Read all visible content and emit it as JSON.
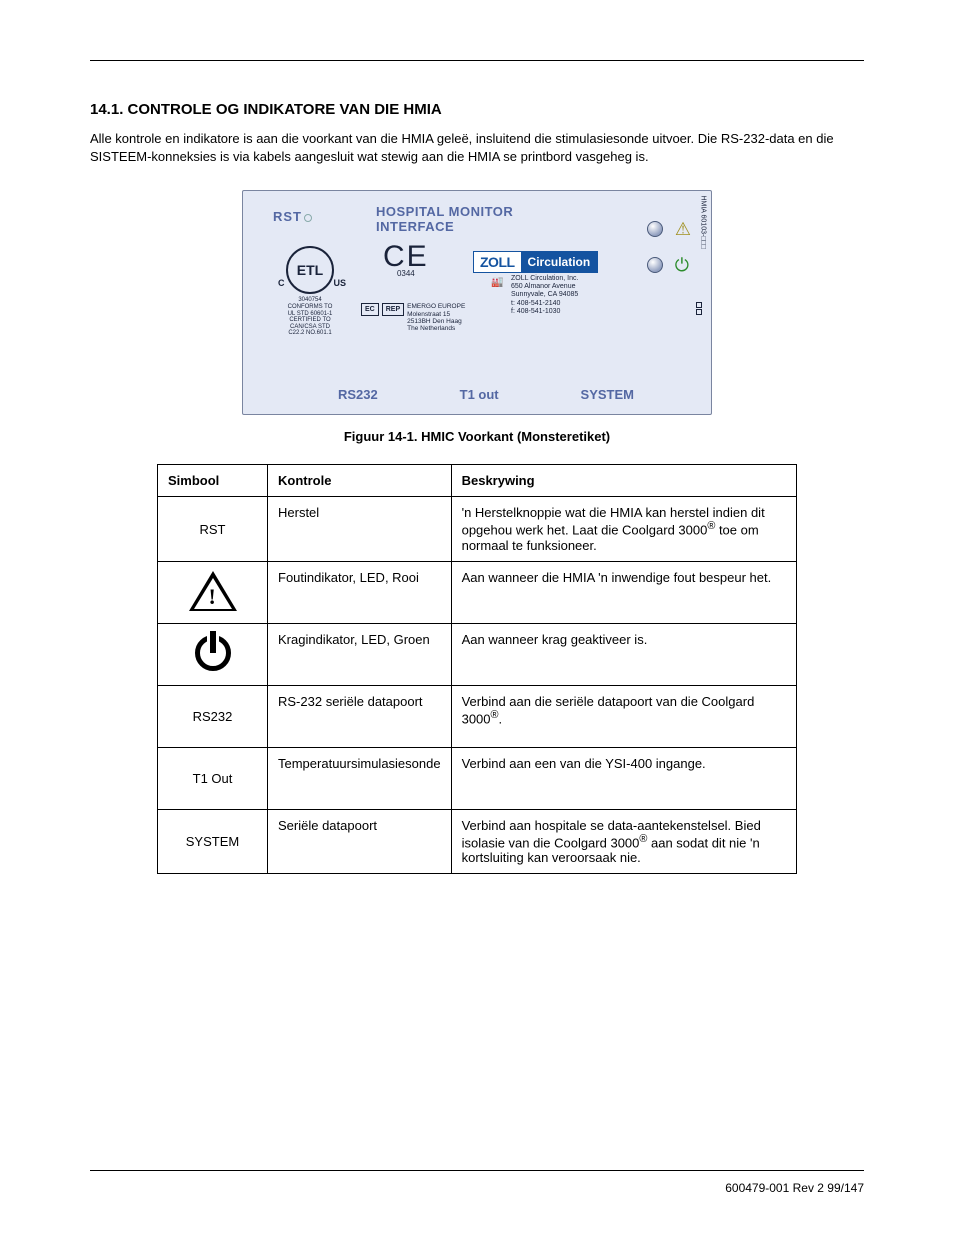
{
  "heading": "14.1. CONTROLE OG INDIKATORE VAN DIE HMIA",
  "intro_paragraph": "Alle kontrole en indikatore is aan die voorkant van die HMIA geleë, insluitend die stimulasiesonde uitvoer. Die RS-232-data en die SISTEEM-konneksies is via kabels aangesluit wat stewig aan die HMIA se printbord vasgeheg is.",
  "panel": {
    "rst": "RST",
    "title_line1": "HOSPITAL MONITOR",
    "title_line2": "INTERFACE",
    "ce_num": "0344",
    "etl_number": "3040754",
    "etl_line1": "CONFORMS TO",
    "etl_line2": "UL STD 60601-1",
    "etl_line3": "CERTIFIED TO",
    "etl_line4": "CAN/CSA STD",
    "etl_line5": "C22.2 NO.601.1",
    "ec_rep_box1": "EC",
    "ec_rep_box2": "REP",
    "ec_rep_line1": "EMERGO EUROPE",
    "ec_rep_line2": "Molenstraat 15",
    "ec_rep_line3": "2513BH Den Haag",
    "ec_rep_line4": "The Netherlands",
    "zoll_brand": "ZOLL",
    "zoll_circ": "Circulation",
    "zoll_addr_l1": "ZOLL Circulation, Inc.",
    "zoll_addr_l2": "650 Almanor Avenue",
    "zoll_addr_l3": "Sunnyvale, CA 94085",
    "zoll_addr_l4": "t: 408-541-2140",
    "zoll_addr_l5": "f: 408-541-1030",
    "label_rs232": "RS232",
    "label_t1out": "T1 out",
    "label_system": "SYSTEM",
    "part_num_strip": "HMIA 60103-□□□"
  },
  "figure_caption": "Figuur 14-1. HMIC Voorkant (Monsteretiket)",
  "table": {
    "headers": [
      "Simbool",
      "Kontrole",
      "Beskrywing"
    ],
    "rows": [
      {
        "symbol_text": "RST",
        "control": "Herstel",
        "desc": "'n Herstelknoppie wat die HMIA kan herstel indien dit opgehou werk het. Laat die Coolgard 3000\n®\n toe om normaal te funksioneer."
      },
      {
        "symbol_type": "warning",
        "control": "Foutindikator, LED, Rooi",
        "desc": "Aan wanneer die HMIA 'n inwendige fout bespeur het."
      },
      {
        "symbol_type": "power",
        "control": "Kragindikator, LED, Groen",
        "desc": "Aan wanneer krag geaktiveer is."
      },
      {
        "symbol_text": "RS232",
        "control": "RS-232 seriële datapoort",
        "desc": "Verbind aan die seriële datapoort van die Coolgard 3000\n®\n."
      },
      {
        "symbol_text": "T1 Out",
        "control": "Temperatuursimulasiesonde",
        "desc": "Verbind aan een van die YSI-400 ingange."
      },
      {
        "symbol_text": "SYSTEM",
        "control": "Seriële datapoort",
        "desc": "Verbind aan hospitale se data-aantekenstelsel. Bied isolasie van die Coolgard 3000\n®\n aan sodat dit nie 'n kortsluiting kan veroorsaak nie."
      }
    ]
  },
  "footer": "600479-001 Rev 2    99/147"
}
